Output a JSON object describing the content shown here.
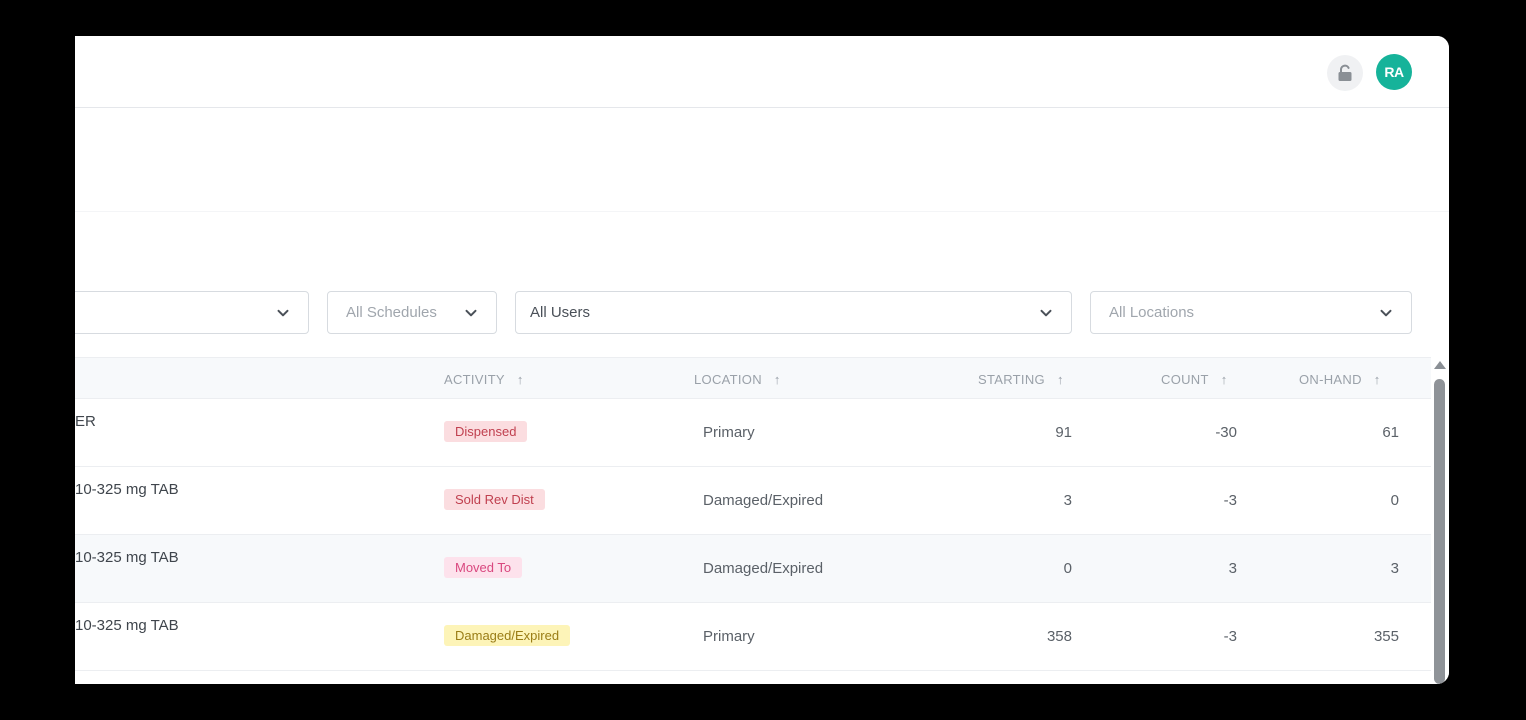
{
  "header": {
    "avatar_initials": "RA",
    "lock_icon": "lock-open-icon"
  },
  "filters": [
    {
      "value": "",
      "placeholder": true
    },
    {
      "value": "All Schedules",
      "placeholder": true
    },
    {
      "value": "All Users",
      "placeholder": false
    },
    {
      "value": "All Locations",
      "placeholder": true
    }
  ],
  "table": {
    "columns": {
      "activity": "ACTIVITY",
      "location": "LOCATION",
      "starting": "STARTING",
      "count": "COUNT",
      "onhand": "ON-HAND"
    },
    "sort_icon": "arrow-up-icon",
    "rows": [
      {
        "drug": "ER",
        "activity": "Dispensed",
        "location": "Primary",
        "starting": "91",
        "count": "-30",
        "onhand": "61"
      },
      {
        "drug": "10-325 mg TAB",
        "activity": "Sold Rev Dist",
        "location": "Damaged/Expired",
        "starting": "3",
        "count": "-3",
        "onhand": "0"
      },
      {
        "drug": "10-325 mg TAB",
        "activity": "Moved To",
        "location": "Damaged/Expired",
        "starting": "0",
        "count": "3",
        "onhand": "3"
      },
      {
        "drug": "10-325 mg TAB",
        "activity": "Damaged/Expired",
        "location": "Primary",
        "starting": "358",
        "count": "-3",
        "onhand": "355"
      }
    ]
  },
  "colors": {
    "avatar_bg": "#16b39a",
    "badge_dispensed_bg": "#fbdde0",
    "badge_dispensed_fg": "#c0404f",
    "badge_sold_bg": "#fbdde0",
    "badge_sold_fg": "#c0404f",
    "badge_moved_bg": "#fde2ec",
    "badge_moved_fg": "#d9487f",
    "badge_damaged_bg": "#fdf4b8",
    "badge_damaged_fg": "#9a7d16"
  }
}
